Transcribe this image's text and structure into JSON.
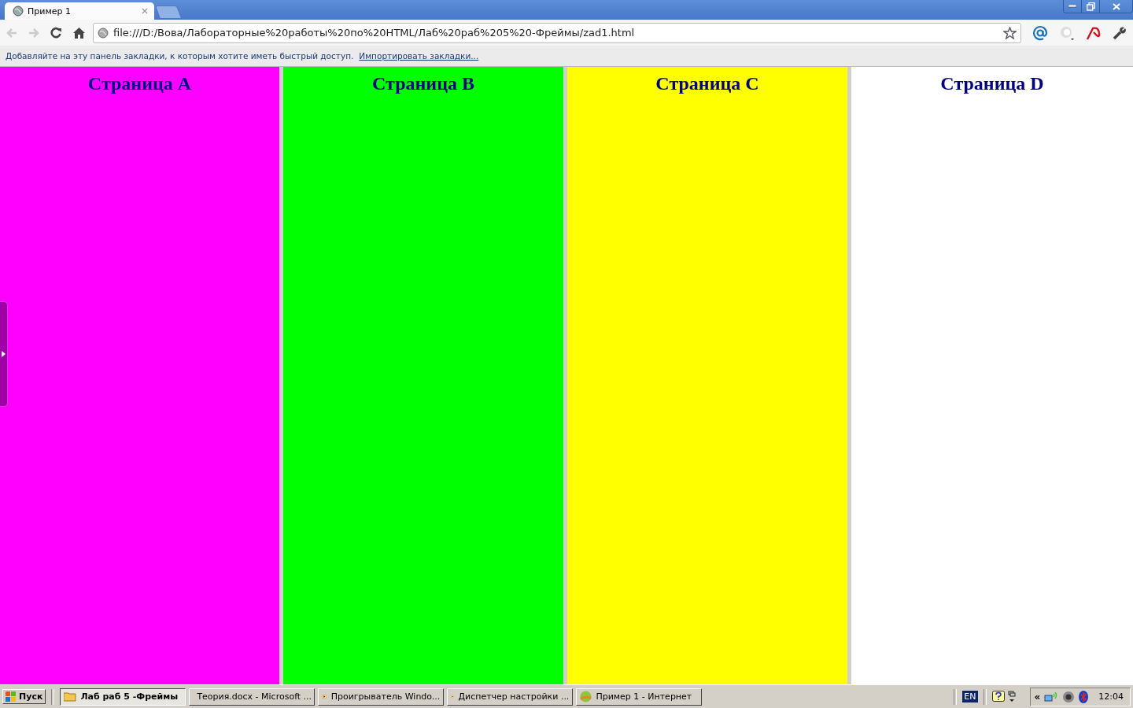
{
  "browser": {
    "tabs": [
      {
        "title": "Пример 1",
        "selected": true
      }
    ],
    "address": "file:///D:/Вова/Лабораторные%20работы%20по%20HTML/Лаб%20раб%205%20-Фреймы/zad1.html",
    "bookmarks_bar": {
      "message": "Добавляйте на эту панель закладки, к которым хотите иметь быстрый доступ.",
      "link": "Импортировать закладки..."
    }
  },
  "frames": [
    {
      "heading": "Страница A",
      "color": "#ff00ff"
    },
    {
      "heading": "Страница B",
      "color": "#00ff00"
    },
    {
      "heading": "Страница C",
      "color": "#ffff00"
    },
    {
      "heading": "Страница D",
      "color": "#ffffff"
    }
  ],
  "taskbar": {
    "start": "Пуск",
    "items": [
      {
        "label": "Лаб раб 5 -Фреймы",
        "kind": "folder",
        "selected": true
      },
      {
        "label": "Теория.docx - Microsoft ...",
        "kind": "word",
        "selected": false
      },
      {
        "label": "Проигрыватель Windo...",
        "kind": "media",
        "selected": false
      },
      {
        "label": "Диспетчер настройки ...",
        "kind": "media",
        "selected": false
      },
      {
        "label": "Пример 1 - Интернет",
        "kind": "browser",
        "selected": false
      }
    ],
    "language": "EN",
    "clock": "12:04",
    "tray_expand": "«"
  }
}
